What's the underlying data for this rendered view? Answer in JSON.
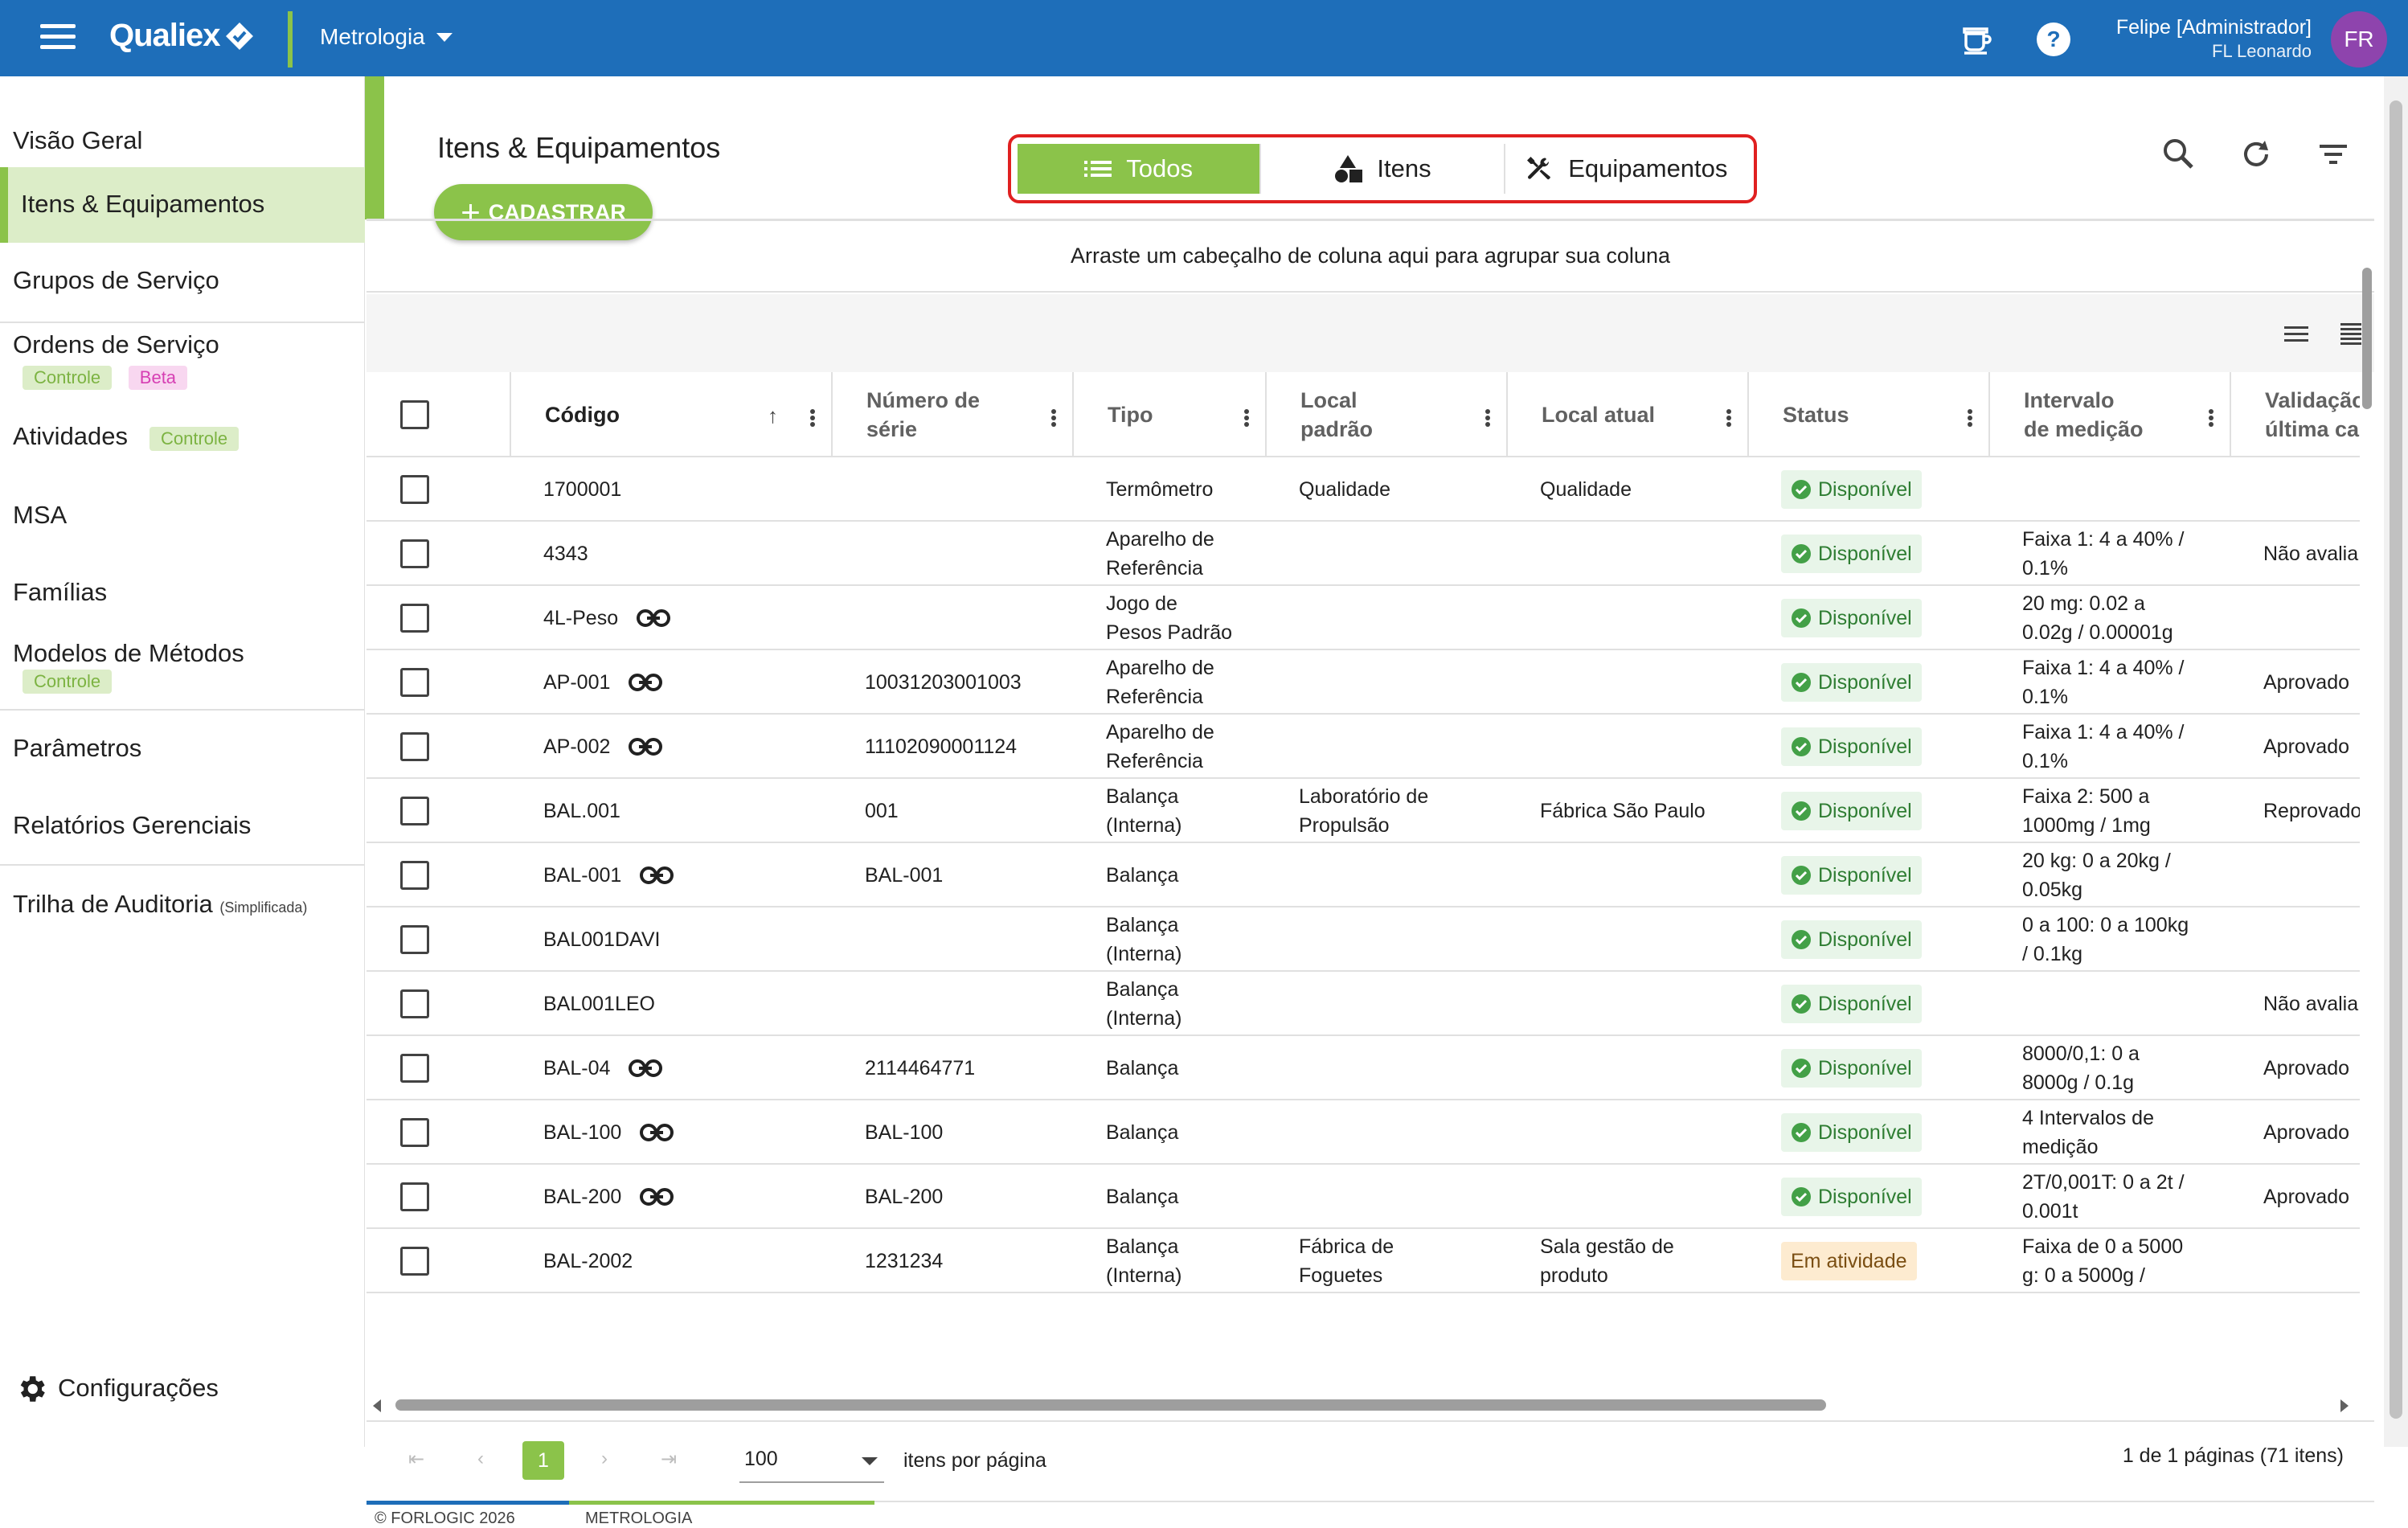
{
  "topbar": {
    "logo": "Qualiex",
    "module": "Metrologia",
    "user_name": "Felipe [Administrador]",
    "user_org": "FL Leonardo",
    "avatar_initials": "FR",
    "bg_color": "#1e6eb9",
    "accent_color": "#8bc34a"
  },
  "sidebar": {
    "items": [
      {
        "label": "Visão Geral"
      },
      {
        "label": "Itens & Equipamentos",
        "active": true
      },
      {
        "label": "Grupos de Serviço"
      },
      {
        "label": "Ordens de Serviço",
        "tags": [
          "Controle",
          "Beta"
        ]
      },
      {
        "label": "Atividades",
        "tags": [
          "Controle"
        ]
      },
      {
        "label": "MSA"
      },
      {
        "label": "Famílias"
      },
      {
        "label": "Modelos de Métodos",
        "tags": [
          "Controle"
        ]
      },
      {
        "label": "Parâmetros"
      },
      {
        "label": "Relatórios Gerenciais"
      },
      {
        "label": "Trilha de Auditoria",
        "note": "(Simplificada)"
      }
    ],
    "settings": "Configurações"
  },
  "page": {
    "title": "Itens & Equipamentos",
    "add_button": "CADASTRAR",
    "segments": [
      "Todos",
      "Itens",
      "Equipamentos"
    ],
    "group_hint": "Arraste um cabeçalho de coluna aqui para agrupar sua coluna"
  },
  "grid": {
    "columns": [
      "Código",
      "Número de série",
      "Tipo",
      "Local padrão",
      "Local atual",
      "Status",
      "Intervalo de medição",
      "Validação última ca"
    ],
    "rows": [
      {
        "codigo": "1700001",
        "link": false,
        "serie": "",
        "tipo": "Termômetro",
        "local_padrao": "Qualidade",
        "local_atual": "Qualidade",
        "status": "Disponível",
        "intervalo": "",
        "validacao": ""
      },
      {
        "codigo": "4343",
        "link": false,
        "serie": "",
        "tipo": "Aparelho de Referência",
        "local_padrao": "",
        "local_atual": "",
        "status": "Disponível",
        "intervalo": "Faixa 1: 4 a 40% / 0.1%",
        "validacao": "Não avalia"
      },
      {
        "codigo": "4L-Peso",
        "link": true,
        "serie": "",
        "tipo": "Jogo de Pesos Padrão",
        "local_padrao": "",
        "local_atual": "",
        "status": "Disponível",
        "intervalo": "20 mg: 0.02 a 0.02g / 0.00001g",
        "validacao": ""
      },
      {
        "codigo": "AP-001",
        "link": true,
        "serie": "10031203001003",
        "tipo": "Aparelho de Referência",
        "local_padrao": "",
        "local_atual": "",
        "status": "Disponível",
        "intervalo": "Faixa 1: 4 a 40% / 0.1%",
        "validacao": "Aprovado"
      },
      {
        "codigo": "AP-002",
        "link": true,
        "serie": "11102090001124",
        "tipo": "Aparelho de Referência",
        "local_padrao": "",
        "local_atual": "",
        "status": "Disponível",
        "intervalo": "Faixa 1: 4 a 40% / 0.1%",
        "validacao": "Aprovado"
      },
      {
        "codigo": "BAL.001",
        "link": false,
        "serie": "001",
        "tipo": "Balança (Interna)",
        "local_padrao": "Laboratório de Propulsão",
        "local_atual": "Fábrica São Paulo",
        "status": "Disponível",
        "intervalo": "Faixa 2: 500 a 1000mg / 1mg",
        "validacao": "Reprovado"
      },
      {
        "codigo": "BAL-001",
        "link": true,
        "serie": "BAL-001",
        "tipo": "Balança",
        "local_padrao": "",
        "local_atual": "",
        "status": "Disponível",
        "intervalo": "20 kg: 0 a 20kg / 0.05kg",
        "validacao": ""
      },
      {
        "codigo": "BAL001DAVI",
        "link": false,
        "serie": "",
        "tipo": "Balança (Interna)",
        "local_padrao": "",
        "local_atual": "",
        "status": "Disponível",
        "intervalo": "0 a 100: 0 a 100kg / 0.1kg",
        "validacao": ""
      },
      {
        "codigo": "BAL001LEO",
        "link": false,
        "serie": "",
        "tipo": "Balança (Interna)",
        "local_padrao": "",
        "local_atual": "",
        "status": "Disponível",
        "intervalo": "",
        "validacao": "Não avalia"
      },
      {
        "codigo": "BAL-04",
        "link": true,
        "serie": "2114464771",
        "tipo": "Balança",
        "local_padrao": "",
        "local_atual": "",
        "status": "Disponível",
        "intervalo": "8000/0,1: 0 a 8000g / 0.1g",
        "validacao": "Aprovado"
      },
      {
        "codigo": "BAL-100",
        "link": true,
        "serie": "BAL-100",
        "tipo": "Balança",
        "local_padrao": "",
        "local_atual": "",
        "status": "Disponível",
        "intervalo": "4 Intervalos de medição",
        "validacao": "Aprovado"
      },
      {
        "codigo": "BAL-200",
        "link": true,
        "serie": "BAL-200",
        "tipo": "Balança",
        "local_padrao": "",
        "local_atual": "",
        "status": "Disponível",
        "intervalo": "2T/0,001T: 0 a 2t / 0.001t",
        "validacao": "Aprovado"
      },
      {
        "codigo": "BAL-2002",
        "link": false,
        "serie": "1231234",
        "tipo": "Balança (Interna)",
        "local_padrao": "Fábrica de Foguetes",
        "local_atual": "Sala gestão de produto",
        "status": "Em atividade",
        "intervalo": "Faixa de 0 a 5000 g: 0 a 5000g /",
        "validacao": ""
      }
    ]
  },
  "pager": {
    "current": "1",
    "page_size": "100",
    "per_page_label": "itens por página",
    "info": "1 de 1 páginas (71 itens)"
  },
  "footer": {
    "copyright": "© FORLOGIC 2026",
    "module": "METROLOGIA"
  }
}
